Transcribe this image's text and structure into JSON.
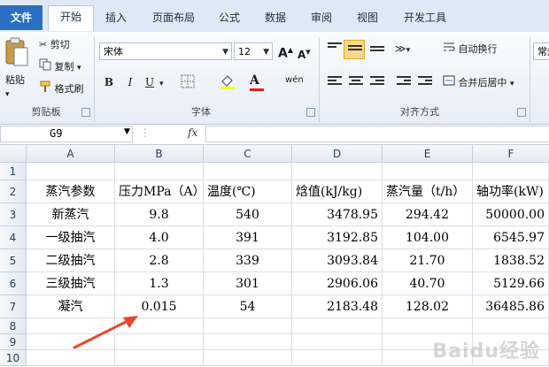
{
  "ribbon_tabs": [
    "文件",
    "开始",
    "插入",
    "页面布局",
    "公式",
    "数据",
    "审阅",
    "视图",
    "开发工具"
  ],
  "clipboard": {
    "paste": "粘贴",
    "cut": "剪切",
    "copy": "复制",
    "format_painter": "格式刷",
    "group_label": "剪贴板"
  },
  "font": {
    "name": "宋体",
    "size": "12",
    "group_label": "字体",
    "bold": "B",
    "italic": "I",
    "underline": "U",
    "wen": "wén"
  },
  "alignment": {
    "wrap": "自动换行",
    "merge": "合并后居中",
    "group_label": "对齐方式"
  },
  "number": {
    "format": "常规"
  },
  "name_box": "G9",
  "fx_label": "fx",
  "columns": [
    "A",
    "B",
    "C",
    "D",
    "E",
    "F"
  ],
  "rows": [
    "1",
    "2",
    "3",
    "4",
    "5",
    "6",
    "7",
    "8",
    "9",
    "10"
  ],
  "table": {
    "header": [
      "蒸汽参数",
      "压力MPa（A）",
      "温度(℃)",
      "焓值(kJ/kg)",
      "蒸汽量（t/h）",
      "轴功率(kW)"
    ],
    "body": [
      [
        "新蒸汽",
        "9.8",
        "540",
        "3478.95",
        "294.42",
        "50000.00"
      ],
      [
        "一级抽汽",
        "4.0",
        "391",
        "3192.85",
        "104.00",
        "6545.97"
      ],
      [
        "二级抽汽",
        "2.8",
        "339",
        "3093.84",
        "21.70",
        "1838.52"
      ],
      [
        "三级抽汽",
        "1.3",
        "301",
        "2906.06",
        "40.70",
        "5129.66"
      ],
      [
        "凝汽",
        "0.015",
        "54",
        "2183.48",
        "128.02",
        "36485.86"
      ]
    ]
  },
  "colors": {
    "file_tab": "#2b6fc2",
    "arrow": "#e8472e"
  },
  "watermark": "Baidu经验"
}
